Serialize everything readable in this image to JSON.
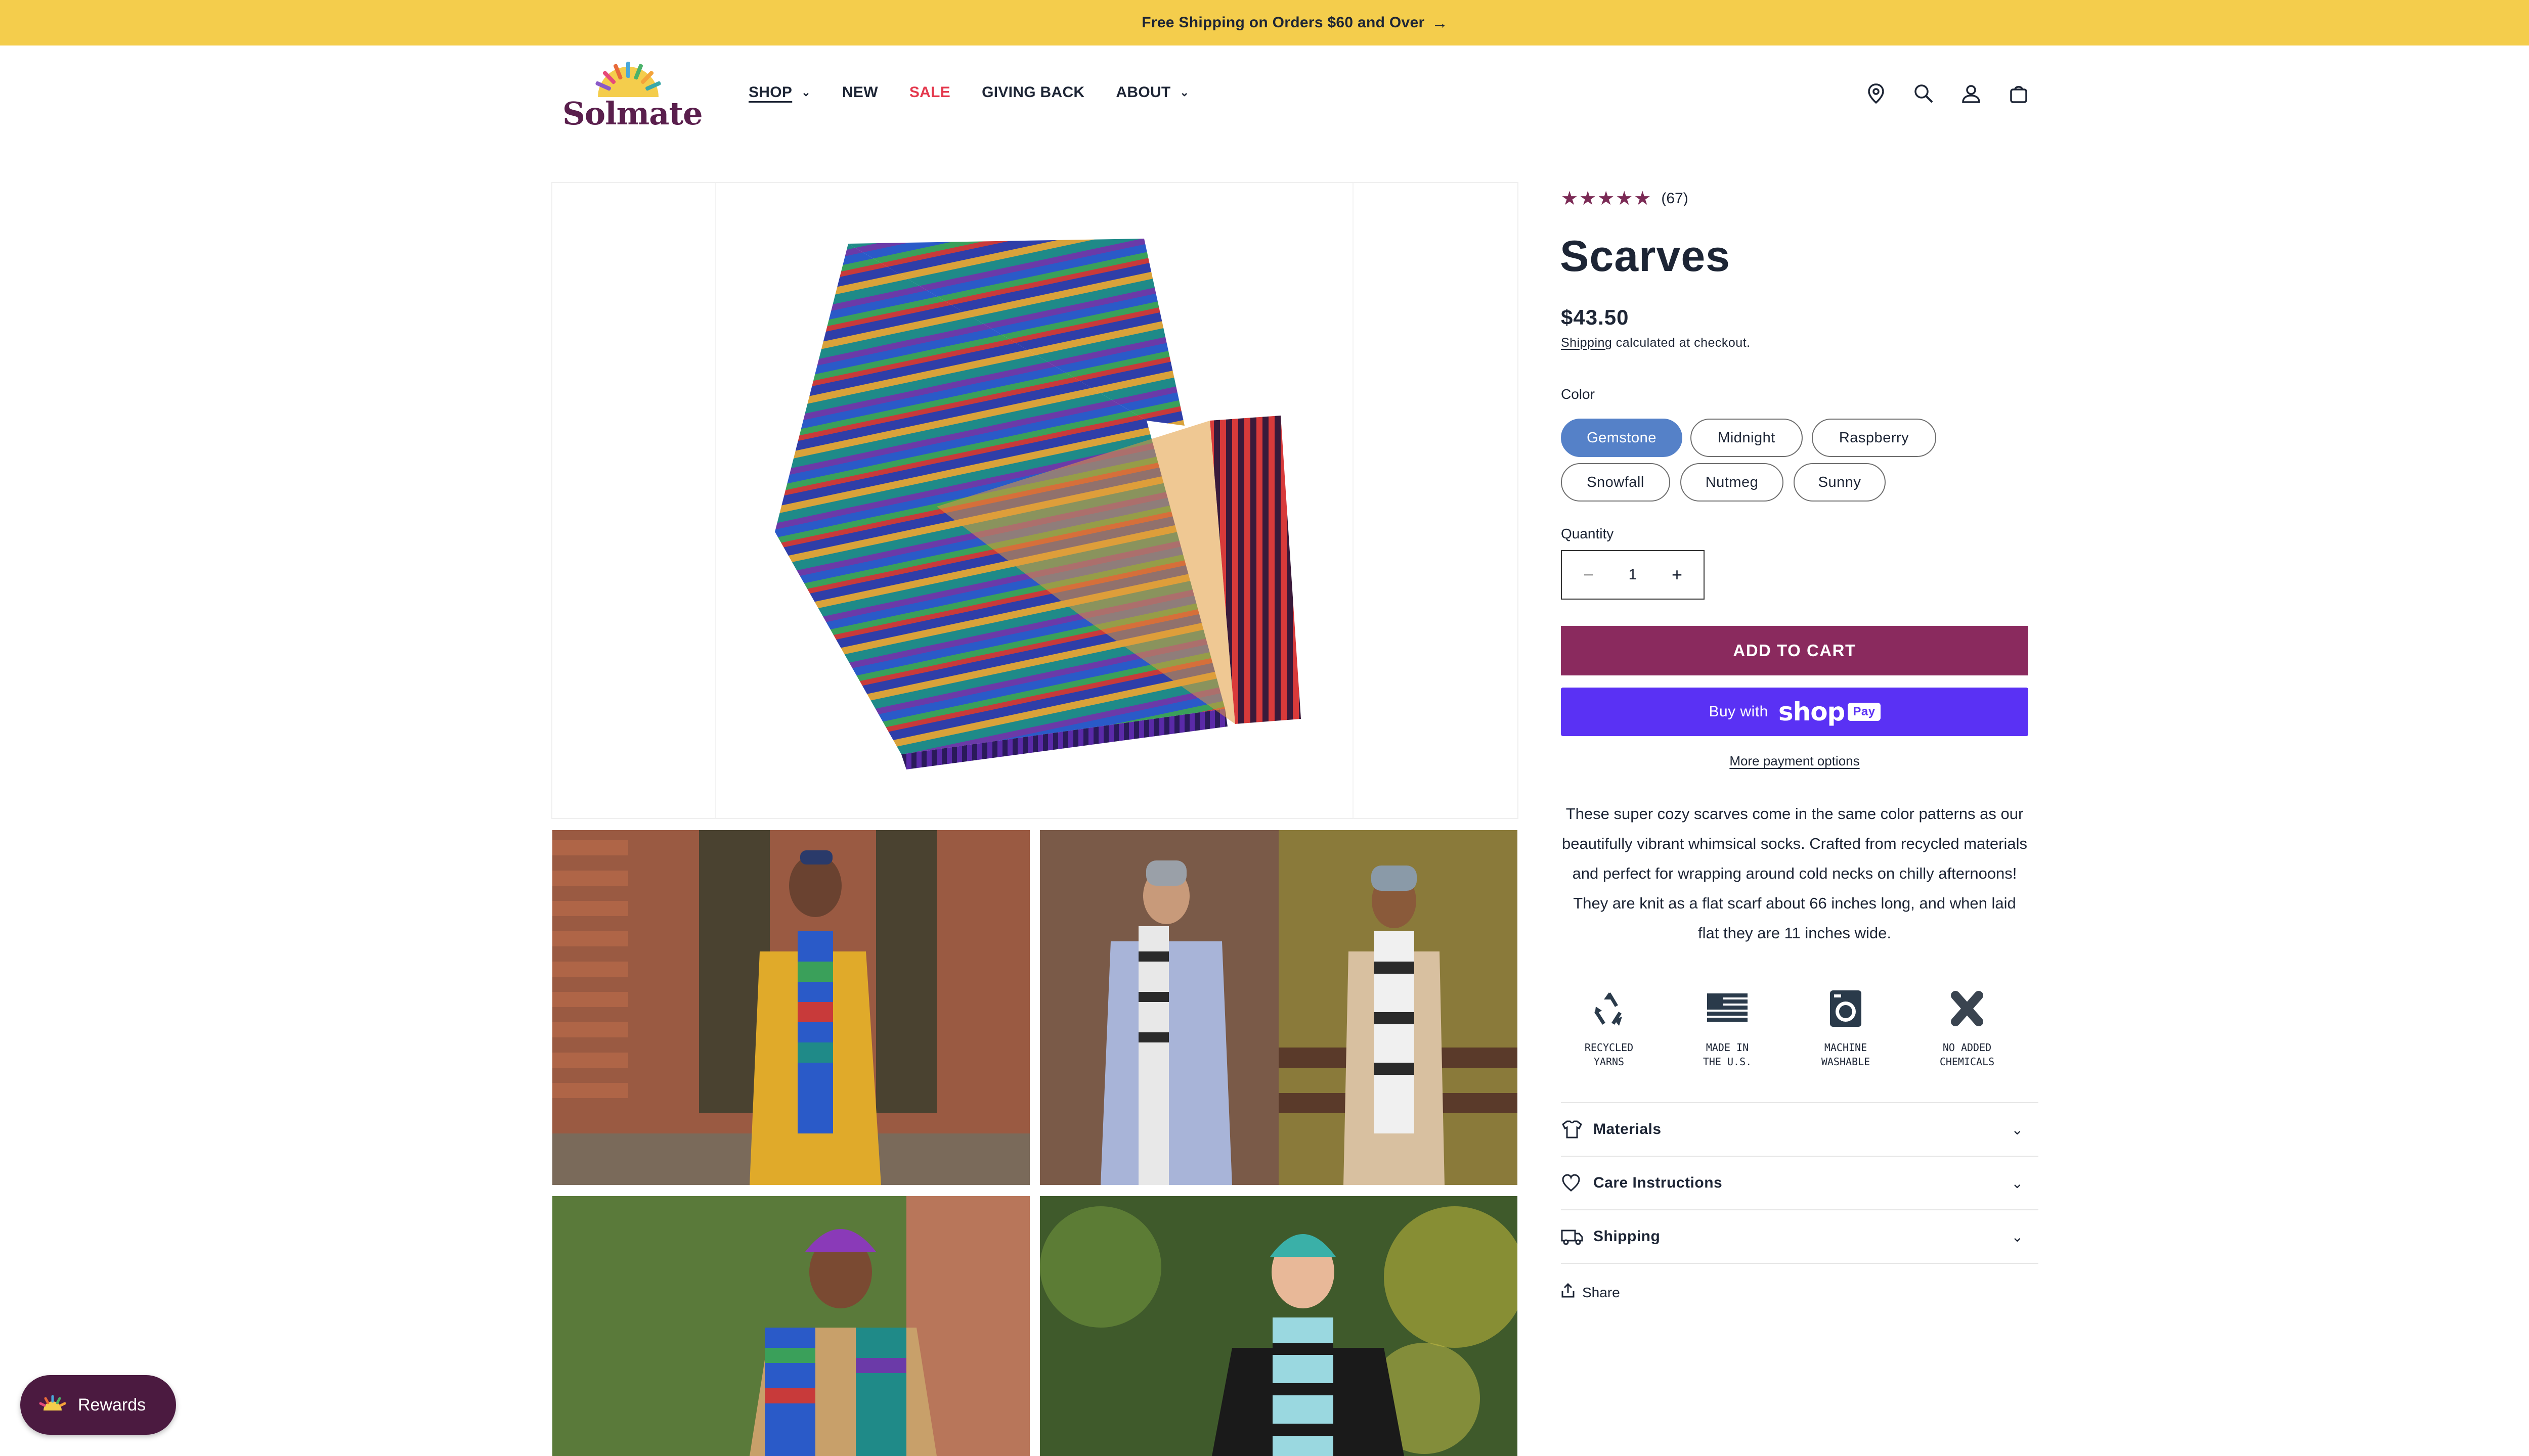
{
  "announcement": {
    "text": "Free Shipping on Orders $60 and Over",
    "arrow": "→"
  },
  "brand": {
    "name": "Solmate"
  },
  "nav": [
    {
      "label": "SHOP",
      "has_dropdown": true,
      "active": true
    },
    {
      "label": "NEW",
      "has_dropdown": false
    },
    {
      "label": "SALE",
      "has_dropdown": false
    },
    {
      "label": "GIVING BACK",
      "has_dropdown": false
    },
    {
      "label": "ABOUT",
      "has_dropdown": true
    }
  ],
  "header_icons": [
    "location-pin-icon",
    "search-icon",
    "account-icon",
    "cart-icon"
  ],
  "product": {
    "rating_stars": "★★★★★",
    "rating": 5,
    "review_count": "(67)",
    "title": "Scarves",
    "price": "$43.50",
    "shipping_link": "Shipping",
    "shipping_text": " calculated at checkout.",
    "color_label": "Color",
    "colors": [
      "Gemstone",
      "Midnight",
      "Raspberry",
      "Snowfall",
      "Nutmeg",
      "Sunny"
    ],
    "selected_color": "Gemstone",
    "quantity_label": "Quantity",
    "quantity": "1",
    "minus": "−",
    "plus": "+",
    "add_to_cart": "ADD TO CART",
    "buy_with": "Buy with",
    "shop_word": "shop",
    "pay_word": "Pay",
    "more_payment": "More payment options",
    "description": "These super cozy scarves come in the same color patterns as our beautifully vibrant whimsical socks. Crafted from recycled materials and perfect for wrapping around cold necks on chilly afternoons! They are knit as a flat scarf about 66 inches long, and when laid flat they are 11 inches wide.",
    "features": [
      {
        "icon": "recycle-icon",
        "line1": "RECYCLED",
        "line2": "YARNS"
      },
      {
        "icon": "us-flag-icon",
        "line1": "MADE IN",
        "line2": "THE U.S."
      },
      {
        "icon": "washing-machine-icon",
        "line1": "MACHINE",
        "line2": "WASHABLE"
      },
      {
        "icon": "no-chemicals-icon",
        "line1": "NO ADDED",
        "line2": "CHEMICALS"
      }
    ],
    "accordions": [
      {
        "icon": "shirt-icon",
        "label": "Materials"
      },
      {
        "icon": "heart-icon",
        "label": "Care Instructions"
      },
      {
        "icon": "truck-icon",
        "label": "Shipping"
      }
    ],
    "share": "Share"
  },
  "rewards": {
    "label": "Rewards"
  },
  "colors": {
    "announcement_bg": "#f4cd4c",
    "sale": "#e4384d",
    "add_to_cart_bg": "#8a2a5e",
    "shop_pay_bg": "#5a31f4",
    "selected_pill": "#5581c8",
    "stars": "#7b2a55",
    "rewards_bg": "#4b1a40"
  }
}
